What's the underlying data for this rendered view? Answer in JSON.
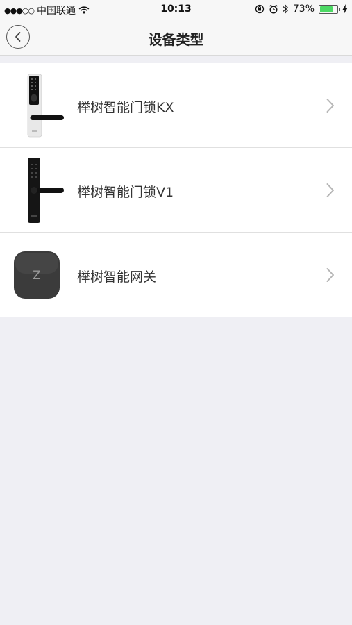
{
  "status_bar": {
    "signal": "●●●○○",
    "carrier": "中国联通",
    "time": "10:13",
    "battery": "73%",
    "battery_level": 0.73,
    "battery_color": "#4cd964"
  },
  "nav": {
    "title": "设备类型",
    "back_icon": "chevron-left-icon"
  },
  "devices": [
    {
      "label": "榉树智能门锁KX",
      "icon": "door-lock-kx-icon"
    },
    {
      "label": "榉树智能门锁V1",
      "icon": "door-lock-v1-icon"
    },
    {
      "label": "榉树智能网关",
      "icon": "gateway-icon"
    }
  ],
  "gateway_logo": "Z"
}
